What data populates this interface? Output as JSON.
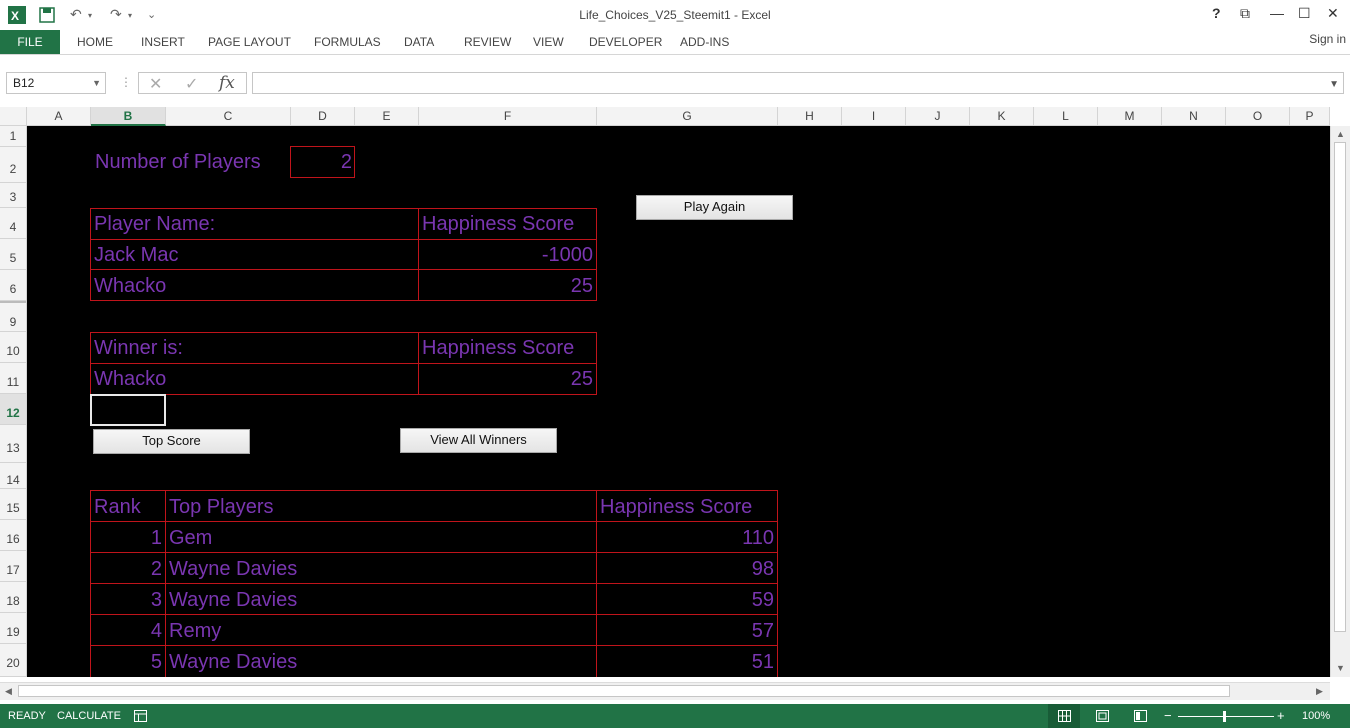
{
  "window": {
    "title": "Life_Choices_V25_Steemit1 - Excel",
    "help": "?",
    "restore_ribbon": "⧉",
    "minimize": "—",
    "maximize": "☐",
    "close": "✕"
  },
  "quick_access": {
    "undo": "↶",
    "redo": "↷",
    "customize": "⌄"
  },
  "ribbon": {
    "file": "FILE",
    "tabs": [
      "HOME",
      "INSERT",
      "PAGE LAYOUT",
      "FORMULAS",
      "DATA",
      "REVIEW",
      "VIEW",
      "DEVELOPER",
      "ADD-INS"
    ],
    "sign_in": "Sign in"
  },
  "formula_bar": {
    "name_box": "B12",
    "cancel": "✕",
    "enter": "✓",
    "fx": "fx",
    "formula": ""
  },
  "columns": [
    "A",
    "B",
    "C",
    "D",
    "E",
    "F",
    "G",
    "H",
    "I",
    "J",
    "K",
    "L",
    "M",
    "N",
    "O",
    "P"
  ],
  "selected_column": "B",
  "rows": [
    "1",
    "2",
    "3",
    "4",
    "5",
    "6",
    "9",
    "10",
    "11",
    "12",
    "13",
    "14",
    "15",
    "16",
    "17",
    "18",
    "19",
    "20"
  ],
  "selected_row": "12",
  "sheet": {
    "num_players_label": "Number of Players",
    "num_players_value": "2",
    "players_table": {
      "header_name": "Player Name:",
      "header_score": "Happiness Score",
      "rows": [
        {
          "name": "Jack Mac",
          "score": "-1000"
        },
        {
          "name": "Whacko",
          "score": "25"
        }
      ]
    },
    "winner_table": {
      "header_name": "Winner is:",
      "header_score": "Happiness Score",
      "name": "Whacko",
      "score": "25"
    },
    "top_table": {
      "header_rank": "Rank",
      "header_players": "Top Players",
      "header_score": "Happiness Score",
      "rows": [
        {
          "rank": "1",
          "name": "Gem",
          "score": "110"
        },
        {
          "rank": "2",
          "name": "Wayne Davies",
          "score": "98"
        },
        {
          "rank": "3",
          "name": "Wayne Davies",
          "score": "59"
        },
        {
          "rank": "4",
          "name": "Remy",
          "score": "57"
        },
        {
          "rank": "5",
          "name": "Wayne Davies",
          "score": "51"
        }
      ]
    },
    "buttons": {
      "play_again": "Play Again",
      "top_score": "Top Score",
      "view_all_winners": "View All Winners"
    }
  },
  "status": {
    "ready": "READY",
    "calculate": "CALCULATE",
    "zoom": "100%",
    "zoom_minus": "−",
    "zoom_plus": "+"
  },
  "colors": {
    "accent": "#217346",
    "cell_text": "#7a36b1",
    "border": "#c0141b",
    "sheet_bg": "#000000"
  }
}
